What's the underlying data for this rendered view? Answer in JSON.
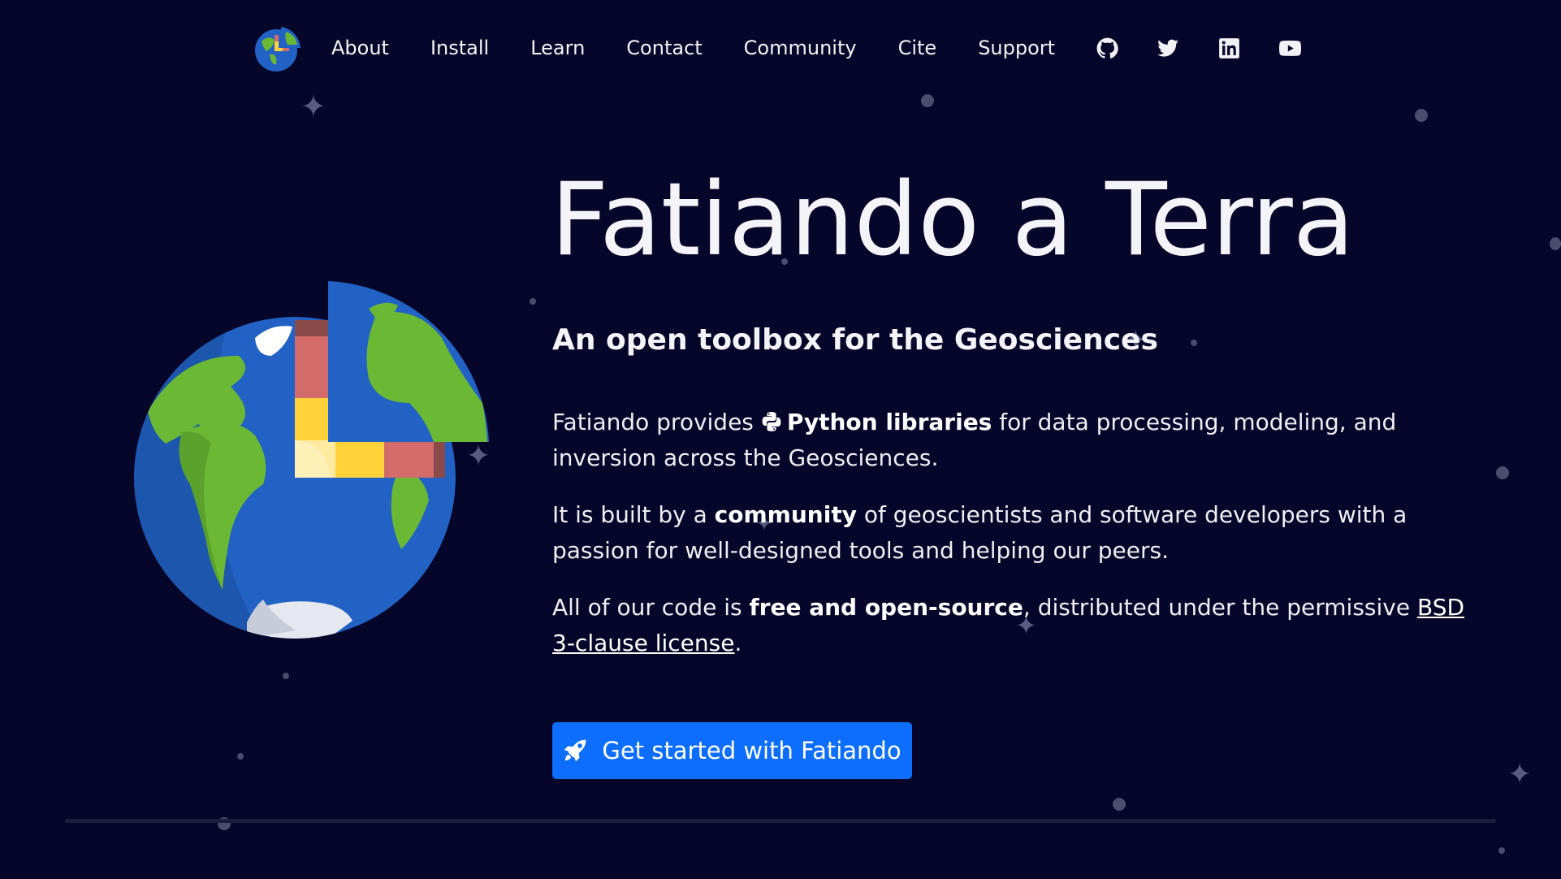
{
  "nav": {
    "logo_icon": "fatiando-globe-logo",
    "links": [
      "About",
      "Install",
      "Learn",
      "Contact",
      "Community",
      "Cite",
      "Support"
    ],
    "social_icons": [
      "github-icon",
      "twitter-icon",
      "linkedin-icon",
      "youtube-icon"
    ]
  },
  "hero": {
    "title": "Fatiando a Terra",
    "subtitle": "An open toolbox for the Geosciences",
    "p1": {
      "before": "Fatiando provides ",
      "python_icon": "python-icon",
      "bold": "Python libraries",
      "after": " for data processing, modeling, and inversion across the Geosciences."
    },
    "p2": {
      "before": "It is built by a ",
      "bold": "community",
      "after": " of geoscientists and software developers with a passion for well-designed tools and helping our peers."
    },
    "p3": {
      "before": "All of our code is ",
      "bold": "free and open-source",
      "middle": ", distributed under the permissive ",
      "link": "BSD 3-clause license",
      "after": "."
    },
    "cta": {
      "icon": "rocket-icon",
      "label": "Get started with Fatiando"
    }
  },
  "colors": {
    "background": "#06062a",
    "accent": "#0d6efd",
    "text": "#f4f4f8"
  }
}
